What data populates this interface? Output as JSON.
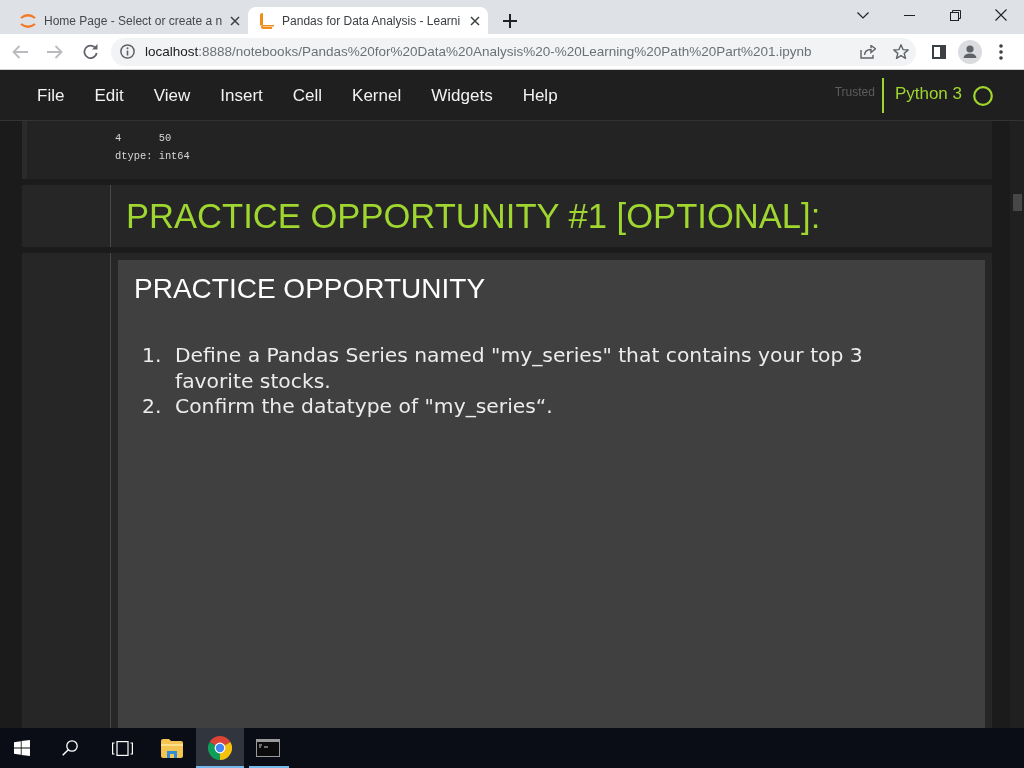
{
  "browser": {
    "tabs": [
      {
        "kind": "arcs",
        "title": "Home Page - Select or create a n",
        "selected": false
      },
      {
        "kind": "book",
        "title": "Pandas for Data Analysis - Learni",
        "selected": true
      }
    ],
    "url": {
      "host": "localhost",
      "path": ":8888/notebooks/Pandas%20for%20Data%20Analysis%20-%20Learning%20Path%20Part%201.ipynb"
    }
  },
  "menubar": {
    "items": [
      "File",
      "Edit",
      "View",
      "Insert",
      "Cell",
      "Kernel",
      "Widgets",
      "Help"
    ],
    "trusted": "Trusted",
    "kernel": "Python 3",
    "kernel_busy": false
  },
  "cells": [
    {
      "kind": "output",
      "lines": [
        "4      50",
        "dtype: int64"
      ]
    },
    {
      "kind": "heading",
      "text": "PRACTICE OPPORTUNITY #1 [OPTIONAL]:"
    },
    {
      "kind": "markdown",
      "title": "PRACTICE OPPORTUNITY",
      "items": [
        {
          "number": "1.",
          "text": "Define a Pandas Series named \"my_series\" that contains your top 3 favorite stocks."
        },
        {
          "number": "2.",
          "text": "Confirm the datatype of \"my_series“."
        }
      ]
    }
  ],
  "taskbar": {
    "apps": [
      {
        "kind": "folder",
        "running": false,
        "selected": false
      },
      {
        "kind": "browser",
        "running": true,
        "selected": true
      },
      {
        "kind": "terminal",
        "running": true,
        "selected": false
      }
    ]
  }
}
